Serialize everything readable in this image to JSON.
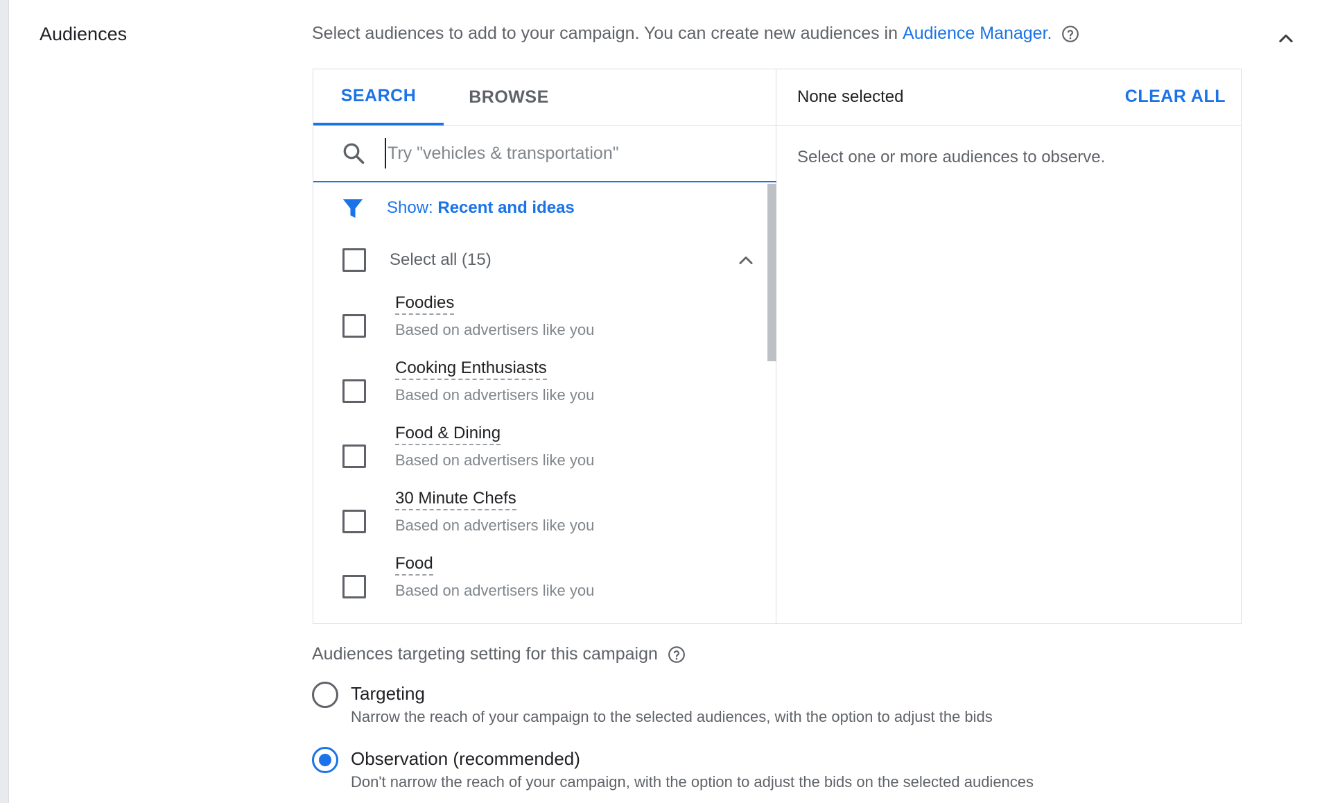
{
  "section": {
    "title": "Audiences",
    "description": "Select audiences to add to your campaign. You can create new audiences in",
    "link_text": "Audience Manager."
  },
  "tabs": [
    {
      "label": "SEARCH",
      "active": true
    },
    {
      "label": "BROWSE",
      "active": false
    }
  ],
  "search": {
    "placeholder": "Try \"vehicles & transportation\""
  },
  "filter": {
    "prefix": "Show:",
    "value": "Recent and ideas"
  },
  "select_all": {
    "label": "Select all (15)"
  },
  "items": [
    {
      "name": "Foodies",
      "subtitle": "Based on advertisers like you"
    },
    {
      "name": "Cooking Enthusiasts",
      "subtitle": "Based on advertisers like you"
    },
    {
      "name": "Food & Dining",
      "subtitle": "Based on advertisers like you"
    },
    {
      "name": "30 Minute Chefs",
      "subtitle": "Based on advertisers like you"
    },
    {
      "name": "Food",
      "subtitle": "Based on advertisers like you"
    }
  ],
  "selection_panel": {
    "status": "None selected",
    "clear_all": "CLEAR ALL",
    "empty_message": "Select one or more audiences to observe."
  },
  "targeting_setting": {
    "title": "Audiences targeting setting for this campaign",
    "options": [
      {
        "label": "Targeting",
        "description": "Narrow the reach of your campaign to the selected audiences, with the option to adjust the bids",
        "selected": false
      },
      {
        "label": "Observation (recommended)",
        "description": "Don't narrow the reach of your campaign, with the option to adjust the bids on the selected audiences",
        "selected": true
      }
    ]
  },
  "icons": {
    "help": "help-circle-icon",
    "collapse": "chevron-up-icon",
    "search": "search-icon",
    "filter": "filter-icon"
  },
  "colors": {
    "accent": "#1a73e8",
    "text_primary": "#202124",
    "text_secondary": "#5f6368",
    "border": "#dadce0"
  }
}
